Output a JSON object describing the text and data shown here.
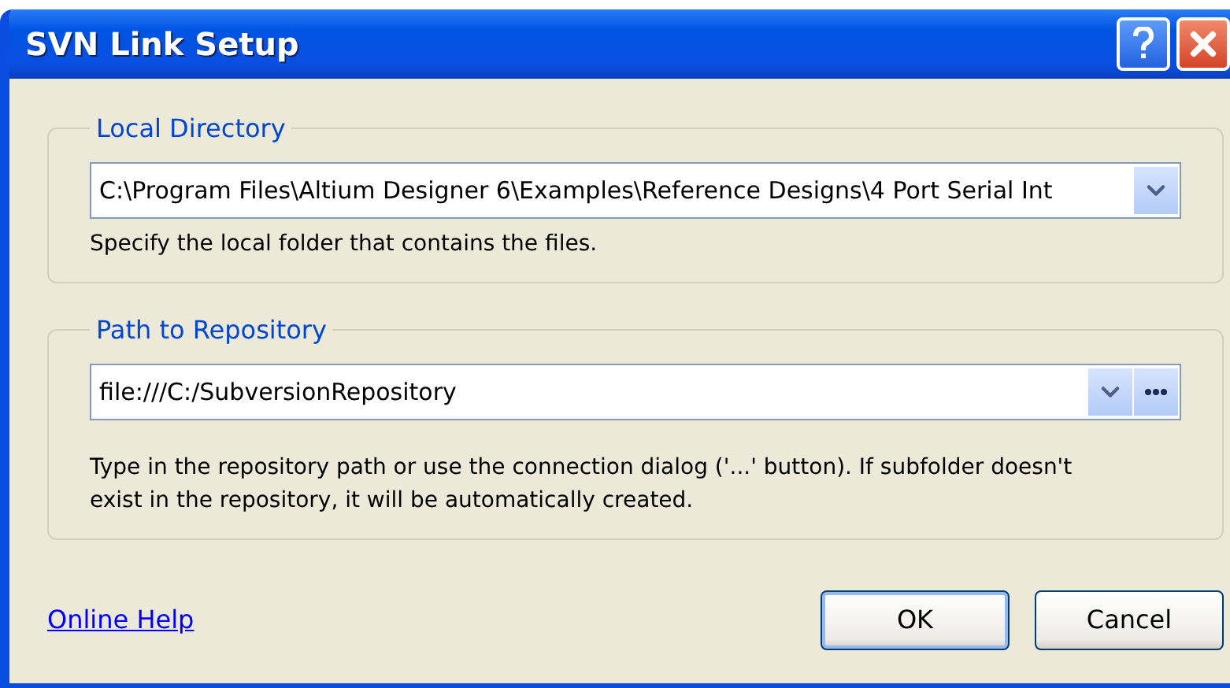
{
  "window": {
    "title": "SVN Link Setup"
  },
  "groups": [
    {
      "label": "Local Directory",
      "value": "C:\\Program Files\\Altium Designer 6\\Examples\\Reference Designs\\4 Port Serial Int",
      "browse": false,
      "hint": "Specify the local folder that contains the files."
    },
    {
      "label": "Path to Repository",
      "value": "file:///C:/SubversionRepository",
      "browse": true,
      "hint": "Type in the repository path or use the connection dialog ('...' button). If subfolder doesn't exist in the repository, it will be automatically created."
    }
  ],
  "help_link": "Online Help",
  "buttons": [
    {
      "label": "OK",
      "default": true
    },
    {
      "label": "Cancel",
      "default": false
    }
  ]
}
